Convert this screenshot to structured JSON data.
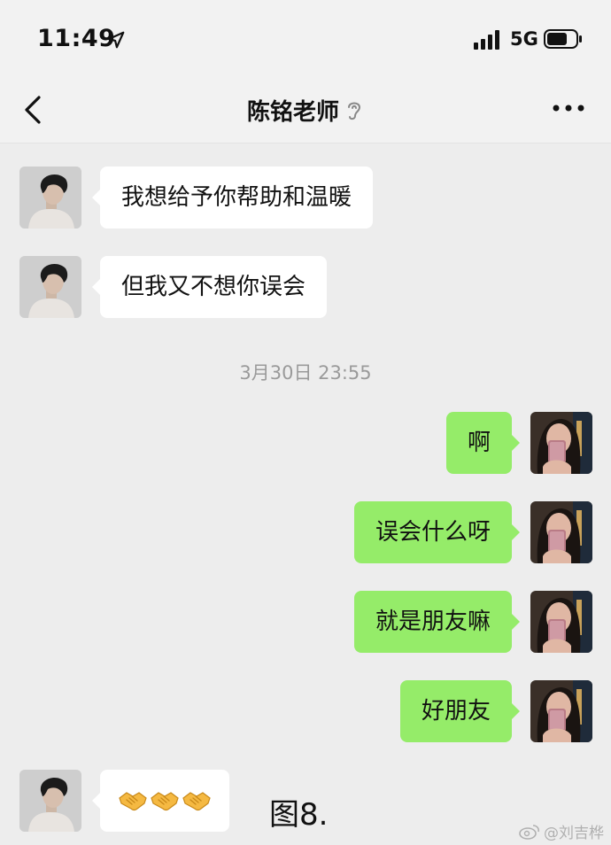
{
  "status_bar": {
    "time": "11:49",
    "network": "5G",
    "icons": [
      "location-arrow-icon",
      "signal-bars-icon",
      "battery-icon"
    ]
  },
  "nav": {
    "title": "陈铭老师",
    "icons": [
      "back-chevron-icon",
      "earpiece-icon",
      "more-dots-icon"
    ]
  },
  "messages": [
    {
      "side": "in",
      "text": "我想给予你帮助和温暖"
    },
    {
      "side": "in",
      "text": "但我又不想你误会"
    },
    {
      "side": "time",
      "text": "3月30日 23:55"
    },
    {
      "side": "out",
      "text": "啊"
    },
    {
      "side": "out",
      "text": "误会什么呀"
    },
    {
      "side": "out",
      "text": "就是朋友嘛"
    },
    {
      "side": "out",
      "text": "好朋友"
    },
    {
      "side": "in",
      "emoji": [
        "handshake-icon",
        "handshake-icon",
        "handshake-icon"
      ]
    }
  ],
  "caption": "图8.",
  "watermark": "@刘吉桦",
  "colors": {
    "background": "#ededed",
    "bubble_out": "#95ec69",
    "bubble_in": "#ffffff",
    "timestamp": "#9a9a9a"
  }
}
